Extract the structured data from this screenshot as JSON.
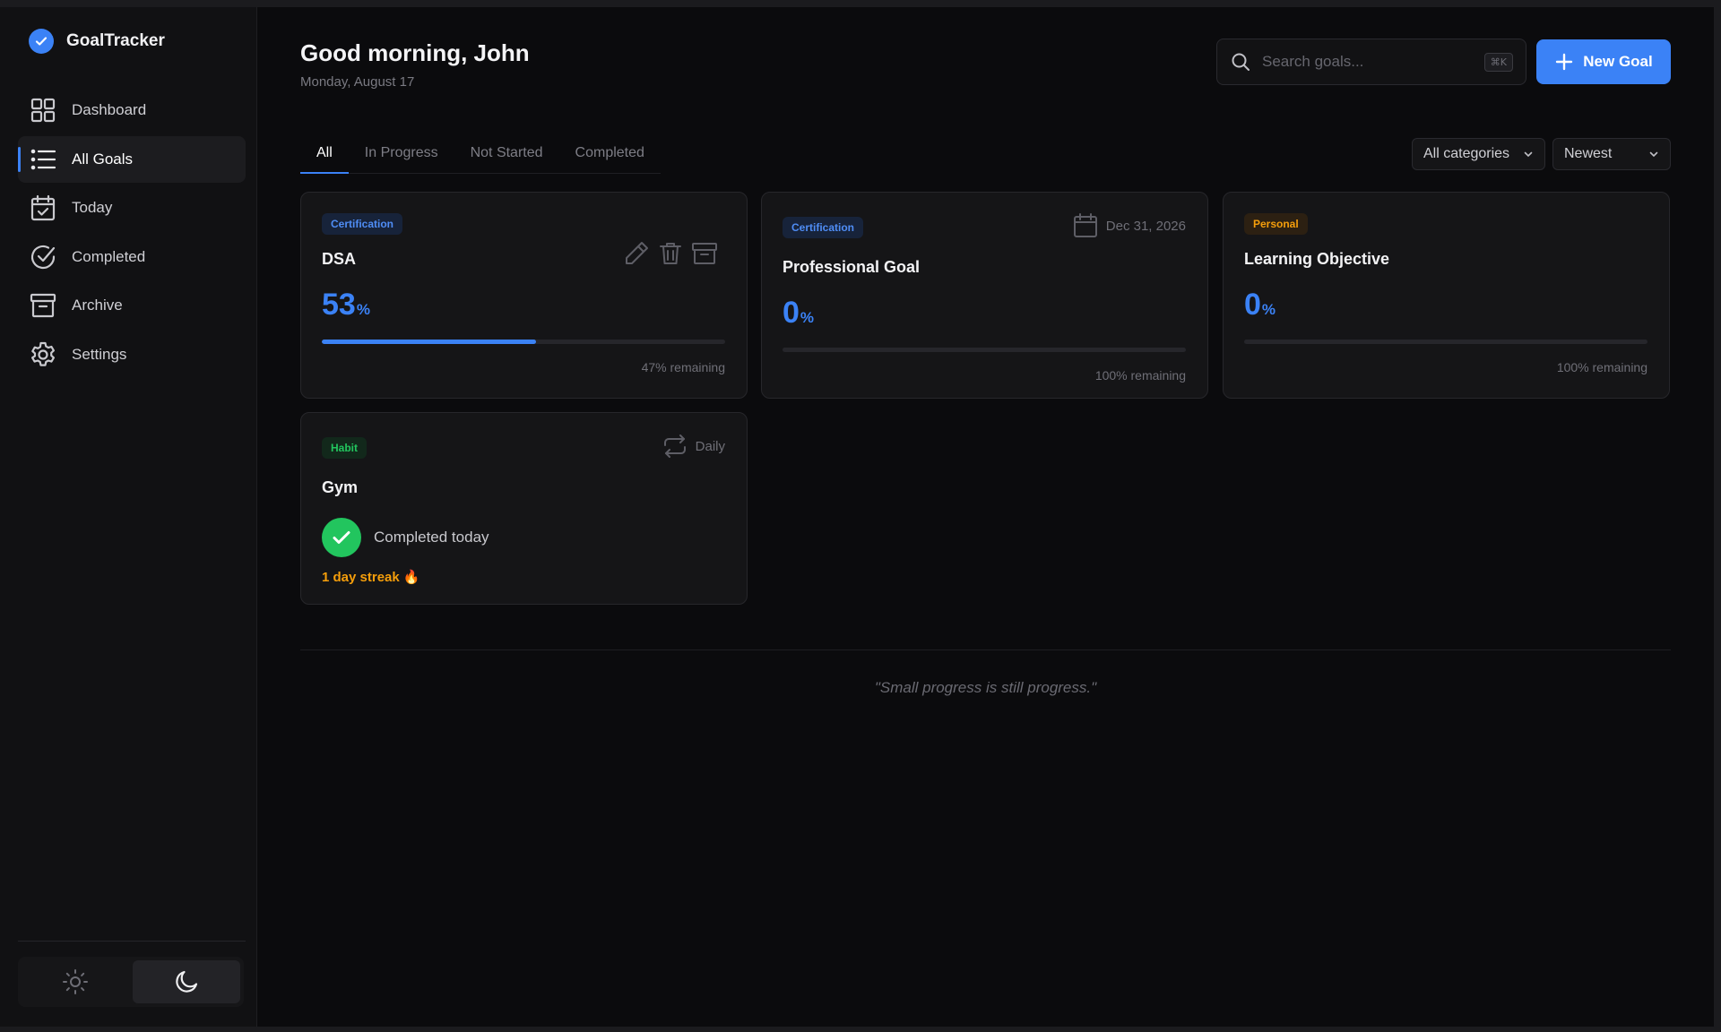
{
  "app": {
    "name": "GoalTracker",
    "accent": "#3b82f6"
  },
  "sidebar": {
    "items": [
      {
        "label": "Dashboard",
        "icon": "grid-icon"
      },
      {
        "label": "All Goals",
        "icon": "list-icon",
        "active": true
      },
      {
        "label": "Today",
        "icon": "calendar-check-icon"
      },
      {
        "label": "Completed",
        "icon": "check-circle-icon"
      },
      {
        "label": "Archive",
        "icon": "archive-icon"
      },
      {
        "label": "Settings",
        "icon": "gear-icon"
      }
    ],
    "theme": {
      "light_icon": "sun-icon",
      "dark_icon": "moon-icon",
      "selected": "dark"
    }
  },
  "header": {
    "greeting": "Good morning, John",
    "date": "Monday, August 17",
    "search_placeholder": "Search goals...",
    "search_shortcut": "⌘K",
    "new_goal_label": "New Goal"
  },
  "tabs": [
    {
      "label": "All",
      "active": true
    },
    {
      "label": "In Progress"
    },
    {
      "label": "Not Started"
    },
    {
      "label": "Completed"
    }
  ],
  "filters": {
    "category": "All categories",
    "sort": "Newest"
  },
  "goals": [
    {
      "category": "Certification",
      "title": "DSA",
      "percent": "53",
      "progress": 0.53,
      "remaining": "47% remaining"
    },
    {
      "category": "Certification",
      "title": "Professional Goal",
      "due": "Dec 31, 2026",
      "percent": "0",
      "progress": 0,
      "remaining": "100% remaining"
    },
    {
      "category": "Personal",
      "title": "Learning Objective",
      "percent": "0",
      "progress": 0,
      "remaining": "100% remaining"
    }
  ],
  "habit": {
    "category": "Habit",
    "title": "Gym",
    "frequency": "Daily",
    "status": "Completed today",
    "streak": "1 day streak 🔥"
  },
  "quote": "\"Small progress is still progress.\"",
  "colors": {
    "certification": "#4f8df5",
    "personal": "#f59e0b",
    "habit": "#22c55e"
  }
}
